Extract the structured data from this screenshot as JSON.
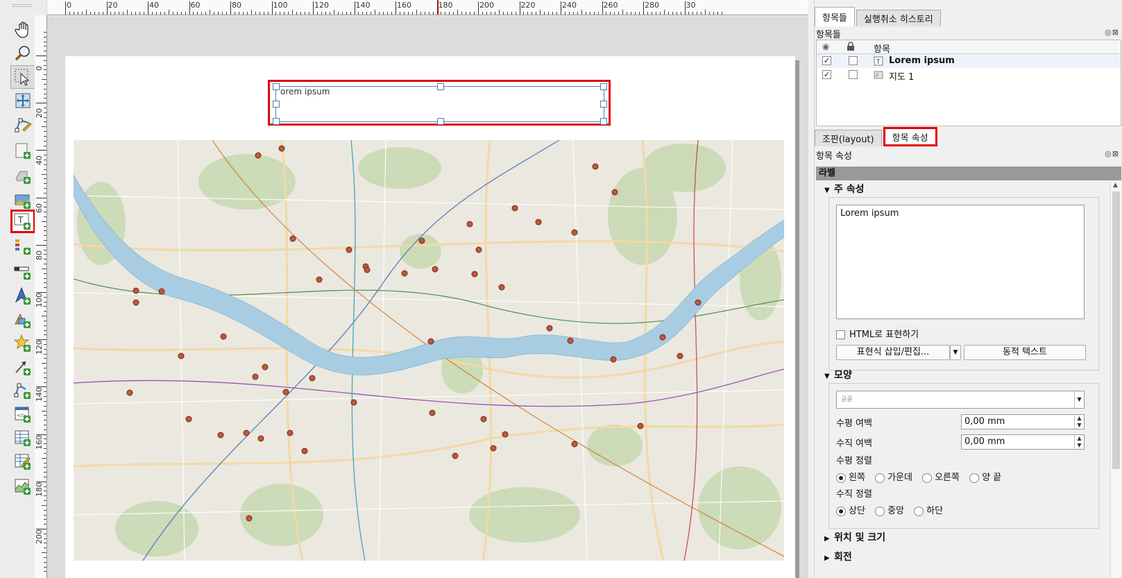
{
  "toolbar": {
    "tools": [
      {
        "name": "pan-tool-button",
        "icon": "hand-icon"
      },
      {
        "name": "zoom-tool-button",
        "icon": "magnifier-icon"
      },
      {
        "name": "select-move-tool-button",
        "icon": "select-arrow-icon",
        "active": true
      },
      {
        "name": "move-content-tool-button",
        "icon": "move-content-icon"
      },
      {
        "name": "edit-nodes-tool-button",
        "icon": "edit-nodes-icon"
      },
      {
        "name": "add-map-button",
        "icon": "add-map-icon"
      },
      {
        "name": "add-3d-map-button",
        "icon": "add-3d-map-icon"
      },
      {
        "name": "add-picture-button",
        "icon": "add-picture-icon"
      },
      {
        "name": "add-label-button",
        "icon": "add-label-icon",
        "highlighted": true
      },
      {
        "name": "add-legend-button",
        "icon": "add-legend-icon"
      },
      {
        "name": "add-scalebar-button",
        "icon": "add-scalebar-icon"
      },
      {
        "name": "add-north-arrow-button",
        "icon": "north-arrow-icon"
      },
      {
        "name": "add-shape-button",
        "icon": "add-shape-icon"
      },
      {
        "name": "add-marker-button",
        "icon": "star-marker-icon"
      },
      {
        "name": "add-arrow-button",
        "icon": "add-arrow-icon"
      },
      {
        "name": "add-node-item-button",
        "icon": "add-node-item-icon"
      },
      {
        "name": "add-html-button",
        "icon": "add-html-icon"
      },
      {
        "name": "add-attribute-table-button",
        "icon": "attribute-table-icon"
      },
      {
        "name": "add-fixed-table-button",
        "icon": "fixed-table-icon"
      },
      {
        "name": "add-elevation-profile-button",
        "icon": "elevation-profile-icon"
      }
    ]
  },
  "ruler": {
    "top_labels": [
      "0",
      "20",
      "40",
      "60",
      "80",
      "100",
      "120",
      "140",
      "160",
      "180",
      "200",
      "220",
      "240",
      "260",
      "280",
      "30"
    ],
    "left_labels": [
      "0",
      "20",
      "40",
      "60",
      "80",
      "100",
      "120",
      "140",
      "160",
      "180",
      "200"
    ]
  },
  "layout_label": {
    "text": "Lorem ipsum",
    "visible_text": "orem ipsum"
  },
  "map": {
    "description_icon": "seoul-map-with-markers",
    "river_color": "#a8cde2",
    "marker_color": "#c0583a"
  },
  "panel": {
    "tabs": [
      {
        "label": "항목들",
        "active": true
      },
      {
        "label": "실행취소 히스토리",
        "active": false
      }
    ],
    "items_title": "항목들",
    "items_header": {
      "name": "항목"
    },
    "items": [
      {
        "name": "Lorem ipsum",
        "visible": true,
        "locked": false,
        "type": "label-item-icon",
        "selected": true
      },
      {
        "name": "지도 1",
        "visible": true,
        "locked": false,
        "type": "map-item-icon",
        "selected": false
      }
    ],
    "lower_tabs": [
      {
        "label": "조판(layout)",
        "active": false
      },
      {
        "label": "항목 속성",
        "active": true,
        "highlighted": true
      }
    ],
    "props_title": "항목 속성",
    "section_label": "라벨",
    "main_props": {
      "title": "주 속성",
      "text": "Lorem ipsum",
      "html_checkbox": "HTML로 표현하기",
      "html_checked": false,
      "insert_expr_button": "표현식 삽입/편집...",
      "dynamic_text_button": "동적 텍스트"
    },
    "appearance": {
      "title": "모양",
      "font_placeholder": "글꼴",
      "h_margin_label": "수평 여백",
      "h_margin_value": "0,00 mm",
      "v_margin_label": "수직 여백",
      "v_margin_value": "0,00 mm",
      "h_align_label": "수평 정렬",
      "h_align_options": [
        "왼쪽",
        "가운데",
        "오른쪽",
        "양 끝"
      ],
      "h_align_selected": 0,
      "v_align_label": "수직 정렬",
      "v_align_options": [
        "상단",
        "중앙",
        "하단"
      ],
      "v_align_selected": 0
    },
    "collapsed_groups": [
      "위치 및 크기",
      "회전"
    ]
  }
}
